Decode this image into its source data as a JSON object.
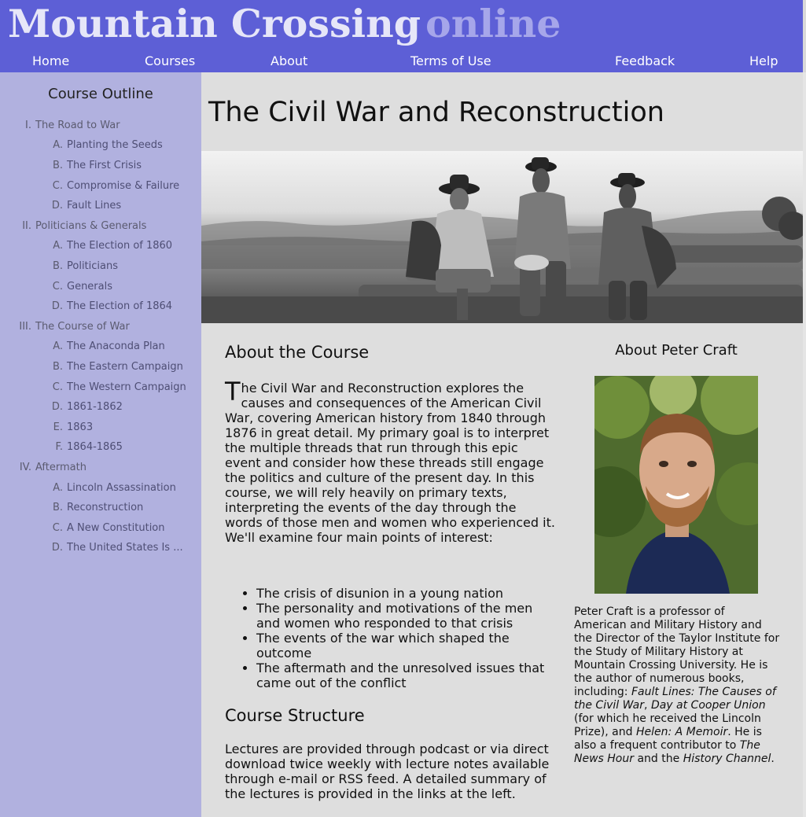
{
  "site": {
    "title_main": "Mountain Crossing",
    "title_sub": "online"
  },
  "nav": {
    "home": "Home",
    "courses": "Courses",
    "about": "About",
    "terms": "Terms of Use",
    "feedback": "Feedback",
    "help": "Help"
  },
  "sidebar": {
    "title": "Course Outline",
    "items": [
      {
        "num": "I.",
        "label": "The Road to War"
      },
      {
        "num": "A.",
        "label": "Planting the Seeds"
      },
      {
        "num": "B.",
        "label": "The First Crisis"
      },
      {
        "num": "C.",
        "label": "Compromise & Failure"
      },
      {
        "num": "D.",
        "label": "Fault Lines"
      },
      {
        "num": "II.",
        "label": "Politicians & Generals"
      },
      {
        "num": "A.",
        "label": "The Election of 1860"
      },
      {
        "num": "B.",
        "label": "Politicians"
      },
      {
        "num": "C.",
        "label": "Generals"
      },
      {
        "num": "D.",
        "label": "The Election of 1864"
      },
      {
        "num": "III.",
        "label": "The Course of War"
      },
      {
        "num": "A.",
        "label": "The Anaconda Plan"
      },
      {
        "num": "B.",
        "label": "The Eastern Campaign"
      },
      {
        "num": "C.",
        "label": "The Western Campaign"
      },
      {
        "num": "D.",
        "label": "1861-1862"
      },
      {
        "num": "E.",
        "label": "1863"
      },
      {
        "num": "F.",
        "label": "1864-1865"
      },
      {
        "num": "IV.",
        "label": "Aftermath"
      },
      {
        "num": "A.",
        "label": "Lincoln Assassination"
      },
      {
        "num": "B.",
        "label": "Reconstruction"
      },
      {
        "num": "C.",
        "label": "A New Constitution"
      },
      {
        "num": "D.",
        "label": "The United States Is ..."
      }
    ]
  },
  "main": {
    "title": "The Civil War and Reconstruction",
    "about_course_heading": "About the Course",
    "intro_first_letter": "T",
    "intro_rest": "he Civil War and Reconstruction explores the causes and consequences of the American Civil War, covering American history from 1840 through 1876 in great detail. My primary goal is to interpret the multiple threads that run through this epic event and consider how these threads still engage the politics and culture of the present day. In this course, we will rely heavily on primary texts, interpreting the events of the day through the words of those men and women who experienced it. We'll examine four main points of interest:",
    "points": [
      "The crisis of disunion in a young nation",
      "The personality and motivations of the men and women who responded to that crisis",
      "The events of the war which shaped the outcome",
      "The aftermath and the unresolved issues that came out of the conflict"
    ],
    "course_structure_heading": "Course Structure",
    "structure_text": "Lectures are provided through podcast or via direct download twice weekly with lecture notes available through e-mail or RSS feed. A detailed summary of the lectures is provided in the links at the left."
  },
  "author": {
    "heading": "About Peter Craft",
    "bio_1": "Peter Craft is a professor of American and Military History and the Director of the Taylor Institute for the Study of Military History at Mountain Crossing University. He is the author of numerous books, including: ",
    "book_1": "Fault Lines: The Causes of the Civil War",
    "sep_1": ", ",
    "book_2": "Day at Cooper Union",
    "bio_2": " (for which he received the Lincoln Prize), and ",
    "book_3": "Helen: A Memoir",
    "bio_3": ". He is also a frequent contributor to ",
    "outlet_1": "The News Hour",
    "bio_4": " and the ",
    "outlet_2": "History Channel",
    "bio_5": "."
  }
}
